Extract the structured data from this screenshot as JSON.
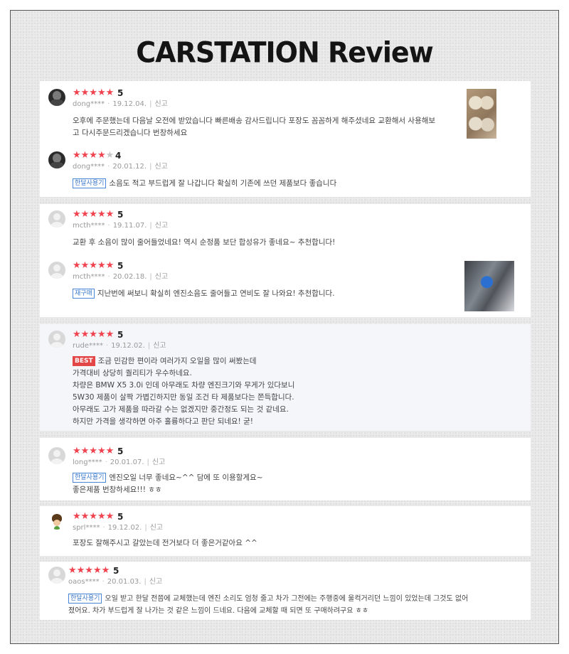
{
  "title": "CARSTATION Review",
  "colors": {
    "star": "#f0434f",
    "badge_blue": "#3a78cc",
    "badge_best": "#e24646"
  },
  "reviews": [
    {
      "stars": "★★★★★",
      "stars_off": "",
      "score": "5",
      "user": "dong****",
      "date": "19.12.04.",
      "report": "신고",
      "badge": "",
      "lines": [
        "오후에 주문했는데 다음날 오전에 받았습니다 빠른배송 감사드립니다 포장도 꼼꼼하게 해주셨네요 교환해서 사용해보",
        "고 다시주문드리겠습니다 번창하세요"
      ],
      "avatar": "photo-avatar",
      "image": "engine-thumbnail"
    },
    {
      "stars": "★★★★",
      "stars_off": "★",
      "score": "4",
      "user": "dong****",
      "date": "20.01.12.",
      "report": "신고",
      "badge": "한달사용기",
      "lines": [
        "소음도 적고 부드럽게 잘 나갑니다 확실히 기존에 쓰던 제품보다 좋습니다"
      ],
      "avatar": "photo-avatar"
    },
    {
      "stars": "★★★★★",
      "stars_off": "",
      "score": "5",
      "user": "mcth****",
      "date": "19.11.07.",
      "report": "신고",
      "badge": "",
      "lines": [
        "교환 후 소음이 많이 줄어들었네요! 역시 순정품 보단 합성유가 좋네요~ 추천합니다!"
      ],
      "avatar": "default-avatar"
    },
    {
      "stars": "★★★★★",
      "stars_off": "",
      "score": "5",
      "user": "mcth****",
      "date": "20.02.18.",
      "report": "신고",
      "badge": "재구매",
      "lines": [
        "지난번에 써보니 확실히 엔진소음도 줄어들고 연비도 잘 나와요! 추천합니다."
      ],
      "avatar": "default-avatar",
      "image": "engine-bay-thumbnail"
    },
    {
      "stars": "★★★★★",
      "stars_off": "",
      "score": "5",
      "user": "rude****",
      "date": "19.12.02.",
      "report": "신고",
      "badge": "BEST",
      "lines": [
        "조금 민감한 편이라 여러가지 오일을 많이 써봤는데",
        "가격대비 상당히 퀄리티가 우수하네요.",
        "차량은 BMW X5 3.0i 인데 아무래도 차량 엔진크기와 무게가 있다보니",
        "5W30 제품이 살짝 가볍긴하지만 동일 조건 타 제품보다는 쫀득합니다.",
        "아무래도 고가 제품을 따라갈 수는 없겠지만 중간정도 되는 것 같네요.",
        "하지만 가격을 생각하면 아주 훌륭하다고 판단 되네요! 굳!"
      ],
      "avatar": "default-avatar"
    },
    {
      "stars": "★★★★★",
      "stars_off": "",
      "score": "5",
      "user": "long****",
      "date": "20.01.07.",
      "report": "신고",
      "badge": "한달사용기",
      "lines": [
        "엔진오일 너무 좋네요~^^ 담에 또 이용할게요~",
        "좋은제품 번창하세요!!! ㅎㅎ"
      ],
      "avatar": "default-avatar"
    },
    {
      "stars": "★★★★★",
      "stars_off": "",
      "score": "5",
      "user": "sprl****",
      "date": "19.12.02.",
      "report": "신고",
      "badge": "",
      "lines": [
        "포장도 잘해주시고 갈았는데 전거보다 더 좋은거같아요 ^^"
      ],
      "avatar": "cartoon-avatar"
    },
    {
      "stars": "★★★★★",
      "stars_off": "",
      "score": "5",
      "user": "oaos****",
      "date": "20.01.03.",
      "report": "신고",
      "badge": "한달사용기",
      "lines": [
        "오일 받고 한달 전쯤에 교체했는데 엔진 소리도 엄청 줄고 차가 그전에는 주행중에 울컥거리던 느낌이 있었는데 그것도 없어",
        "졌어요. 차가 부드럽게 잘 나가는 것 같은 느낌이 드네요. 다음에 교체할 때 되면 또 구매하려구요 ㅎㅎ"
      ],
      "avatar": "default-avatar"
    }
  ]
}
